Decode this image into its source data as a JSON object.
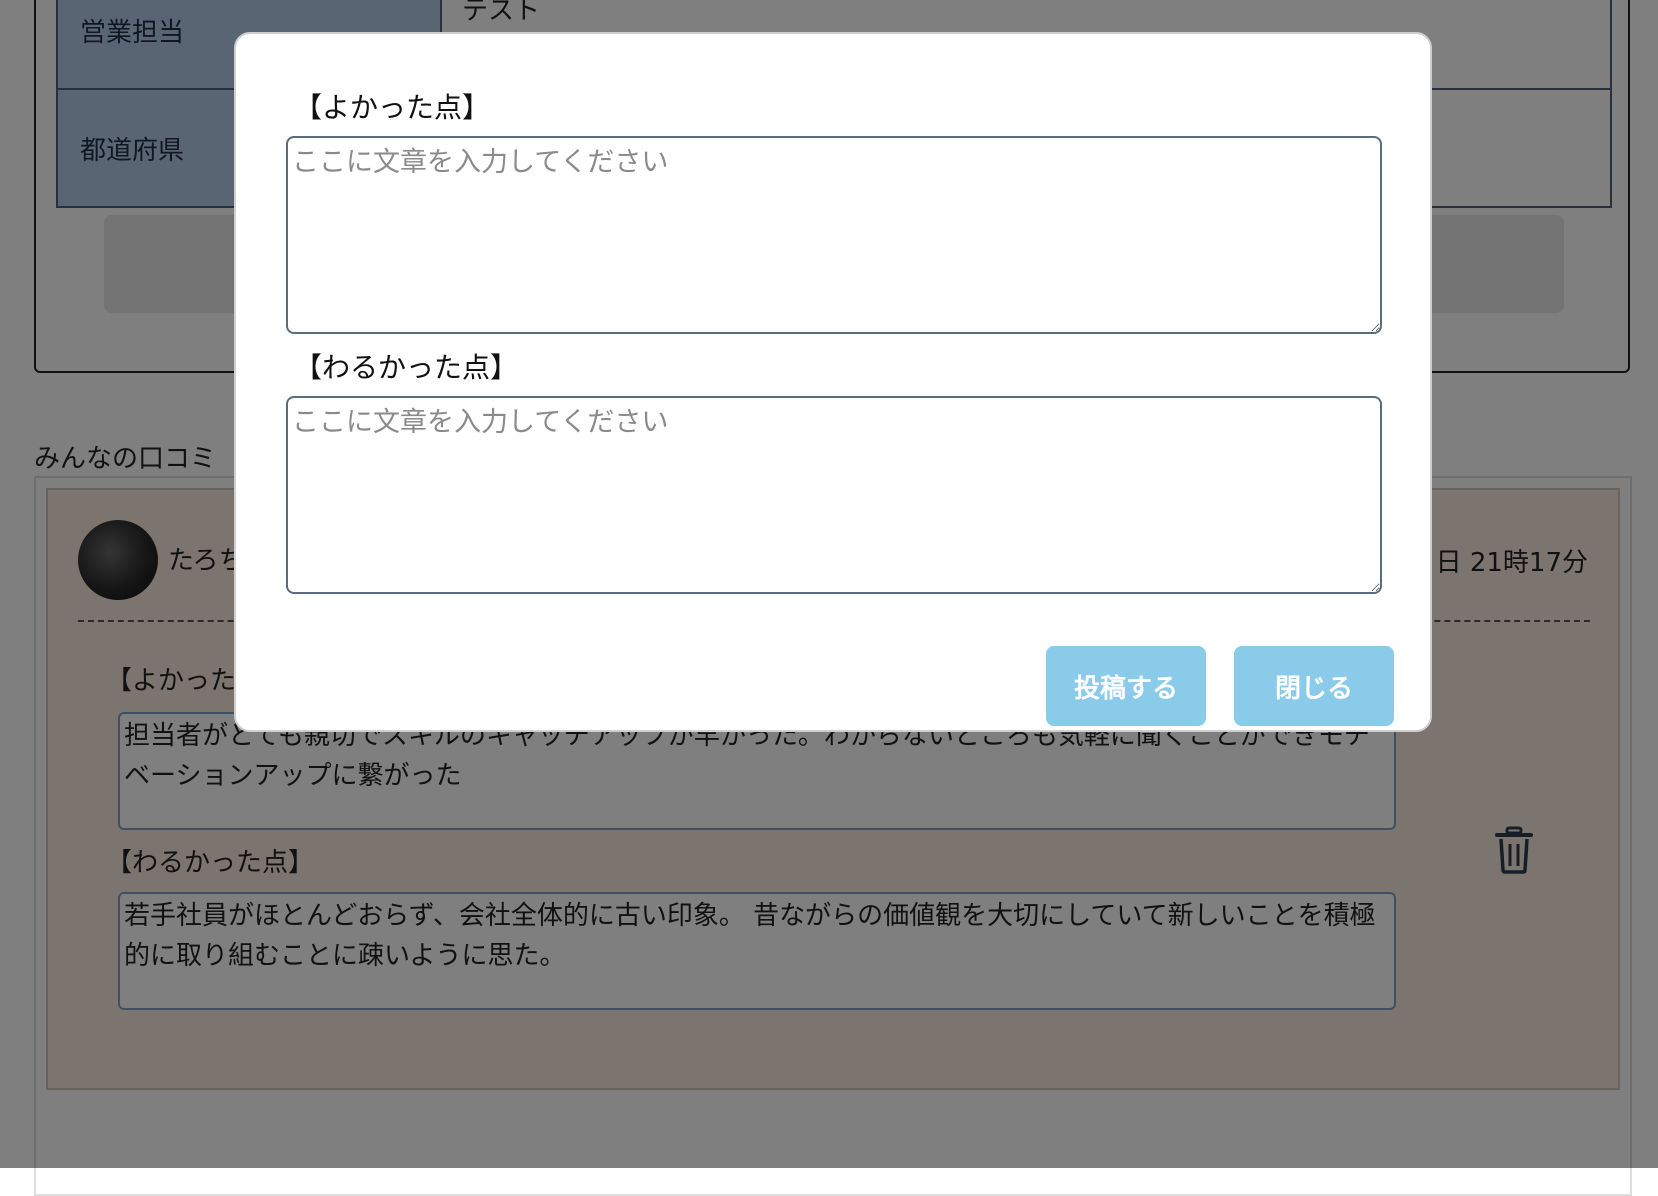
{
  "background": {
    "detail_table": [
      {
        "label": "営業担当",
        "value": "テスト"
      },
      {
        "label": "都道府県",
        "value": ""
      }
    ],
    "reviews_heading": "みんなの口コミ",
    "review": {
      "username": "たろちゃん",
      "date": "日 21時17分",
      "good_label": "【よかった点】",
      "good_text": "担当者がとても親切でスキルのキャッチアップが早かった。わからないところも気軽に聞くことができモチベーションアップに繋がった",
      "bad_label": "【わるかった点】",
      "bad_text": "若手社員がほとんどおらず、会社全体的に古い印象。 昔ながらの価値観を大切にしていて新しいことを積極的に取り組むことに疎いように思た。",
      "delete_icon": "trash-icon"
    }
  },
  "modal": {
    "good_label": "【よかった点】",
    "good_placeholder": "ここに文章を入力してください",
    "bad_label": "【わるかった点】",
    "bad_placeholder": "ここに文章を入力してください",
    "submit_label": "投稿する",
    "close_label": "閉じる"
  },
  "colors": {
    "button": "#89cbe8",
    "overlay": "rgba(0,0,0,0.5)",
    "table_header": "#b5cbe7",
    "review_card": "#f8eadf"
  }
}
